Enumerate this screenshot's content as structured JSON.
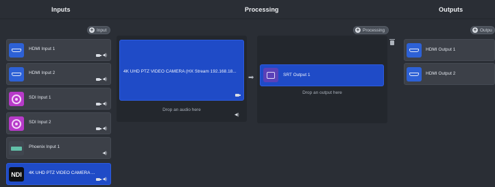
{
  "columns": {
    "inputs_title": "Inputs",
    "processing_title": "Processing",
    "outputs_title": "Outputs"
  },
  "buttons": {
    "add_input": "Input",
    "add_processing": "Processing",
    "add_output": "Outpu"
  },
  "inputs": [
    {
      "label": "HDMI Input 1",
      "icon": "hdmi-icon"
    },
    {
      "label": "HDMI Input 2",
      "icon": "hdmi-icon"
    },
    {
      "label": "SDI Input 1",
      "icon": "sdi-icon"
    },
    {
      "label": "SDI Input 2",
      "icon": "sdi-icon"
    },
    {
      "label": "Phoenix Input 1",
      "icon": "phoenix-icon"
    },
    {
      "label": "4K UHD PTZ VIDEO CAMERA ...",
      "icon": "ndi-icon",
      "icon_text": "NDI"
    }
  ],
  "processing": {
    "source_title": "4K UHD PTZ VIDEO CAMERA (HX Stream 192.168.18...",
    "drop_audio": "Drop an audio here",
    "output_slot": {
      "label": "SRT Output 1"
    },
    "drop_output": "Drop an output here"
  },
  "outputs": [
    {
      "label": "HDMI Output 1"
    },
    {
      "label": "HDMI Output 2"
    }
  ],
  "colors": {
    "background": "#2a2e35",
    "accent_blue": "#1f4bc7",
    "card": "#3c4048",
    "panel": "#23272d"
  }
}
